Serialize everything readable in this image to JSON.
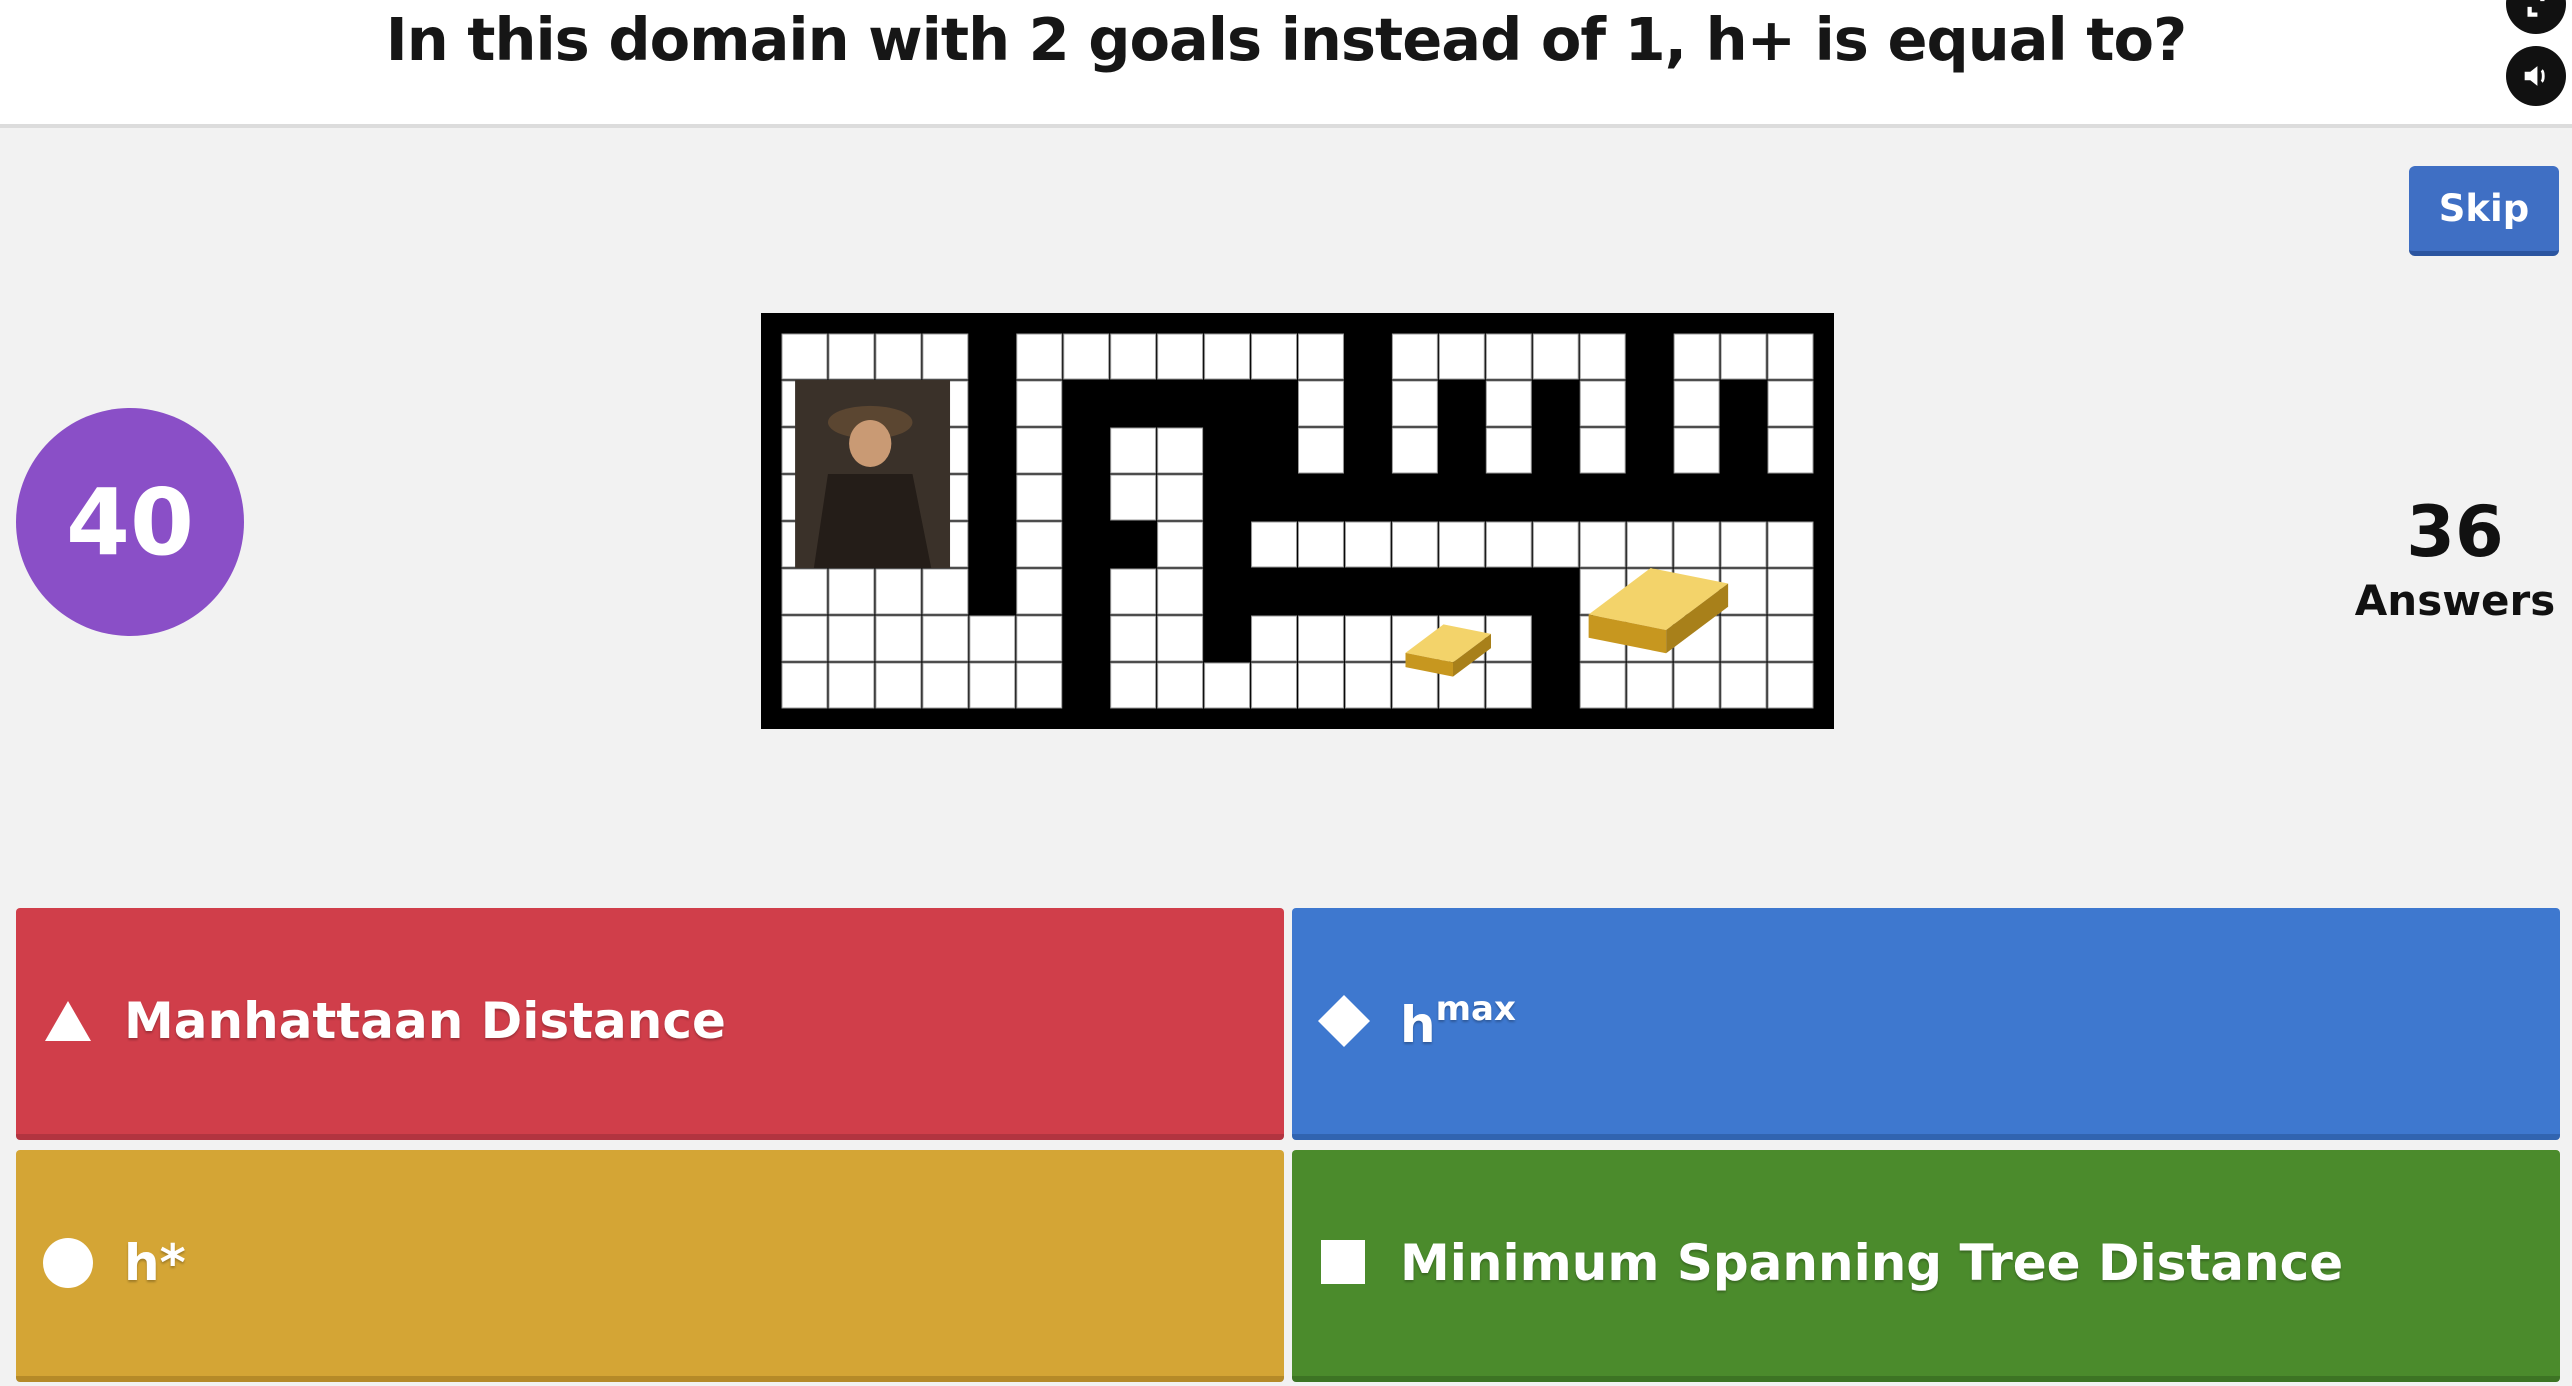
{
  "header": {
    "question": "In this domain with 2 goals instead of 1, h+ is equal to?",
    "fullscreen_icon": "fullscreen-icon",
    "sound_icon": "speaker-icon"
  },
  "controls": {
    "skip_label": "Skip"
  },
  "timer": {
    "seconds": "40",
    "color": "#8a4fc7"
  },
  "answers_count": {
    "number": "36",
    "label": "Answers"
  },
  "answers": [
    {
      "shape": "triangle-icon",
      "label": "Manhattaan Distance",
      "color": "#d03e4a"
    },
    {
      "shape": "diamond-icon",
      "label": "h",
      "superscript": "max",
      "color": "#3e78cf"
    },
    {
      "shape": "circle-icon",
      "label": "h*",
      "color": "#d4a535"
    },
    {
      "shape": "square-icon",
      "label": "Minimum Spanning Tree Distance",
      "color": "#4b8b2c"
    }
  ]
}
